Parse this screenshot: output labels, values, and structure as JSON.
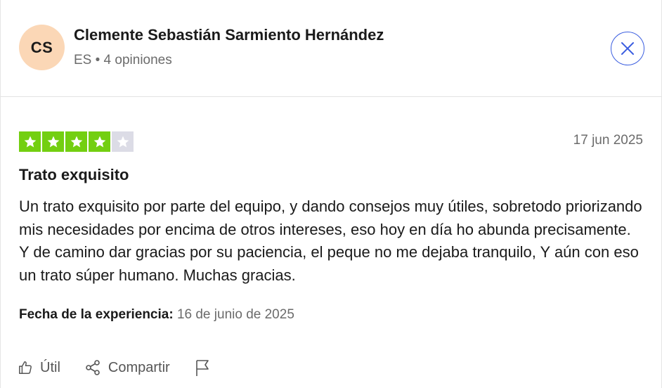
{
  "author": {
    "initials": "CS",
    "name": "Clemente Sebastián Sarmiento Hernández",
    "meta": "ES • 4 opiniones",
    "avatar_color": "#fbd7b6"
  },
  "close_icon": "close-icon",
  "review": {
    "rating": 4,
    "rating_max": 5,
    "star_color_on": "#73cf11",
    "star_color_off": "#dcdce6",
    "date": "17 jun 2025",
    "title": "Trato exquisito",
    "body": "Un trato exquisito por parte del equipo, y dando consejos muy útiles, sobretodo priorizando mis necesidades por encima de otros intereses, eso hoy en día ho abunda precisamente. Y de camino dar gracias por su paciencia, el peque no me dejaba tranquilo, Y aún con eso un trato súper humano. Muchas gracias.",
    "experience_label": "Fecha de la experiencia:",
    "experience_value": "16 de junio de 2025"
  },
  "actions": {
    "useful_label": "Útil",
    "useful_icon": "thumbs-up-icon",
    "share_label": "Compartir",
    "share_icon": "share-icon",
    "report_icon": "flag-icon"
  }
}
